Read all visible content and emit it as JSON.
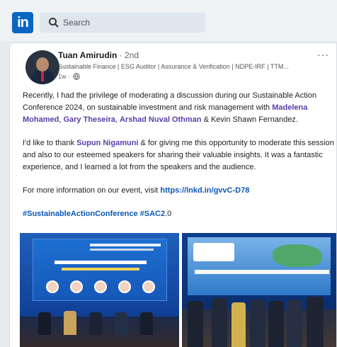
{
  "app": {
    "logo": "in",
    "search_placeholder": "Search",
    "brand_color": "#0a66c2"
  },
  "post": {
    "author_name": "Tuan Amirudin",
    "connection_degree": "· 2nd",
    "headline": "Sustainable Finance | ESG Auditor | Assurance & Verification | NDPE-IRF | TTM...",
    "timestamp": "1w ·",
    "visibility_icon": "globe-icon",
    "more_label": "···",
    "para1_text1": "Recently, I had the privilege of moderating a discussion during our Sustainable Action Conference 2024, on sustainable investment and risk management with",
    "mention_1": "Madelena Mohamed",
    "sep_1": ",",
    "mention_2": "Gary Theseira",
    "sep_2": ",",
    "mention_3": "Arshad Nuval Othman",
    "para1_text2": "& Kevin Shawn Fernandez.",
    "para2_text1": "I'd like to thank",
    "mention_4": "Supun Nigamuni",
    "para2_text2": "&  for giving me this opportunity to moderate this session and also to our esteemed speakers for sharing their valuable insights. It was a fantastic experience, and I learned a lot from the speakers and the audience.",
    "para3_text": "For more information on our event, visit",
    "event_link": "https://lnkd.in/gvvC-D78",
    "hashtag_1": "#SustainableActionConference",
    "hashtag_2": "#SAC2",
    "hashtag_suffix": ".0",
    "link_color": "#0a58b8",
    "mention_color": "#5b3fa8"
  }
}
